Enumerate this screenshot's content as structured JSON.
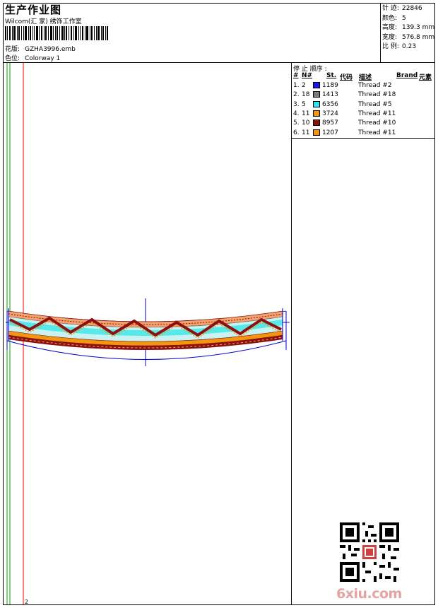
{
  "header": {
    "title": "生产作业图",
    "company": "Wilcom(汇 家) 绣饰工作室",
    "design_label": "花版:",
    "design_value": "GZHA3996.emb",
    "color_label": "色位:",
    "color_value": "Colorway 1"
  },
  "stats": [
    {
      "label": "针 迹:",
      "value": "22846"
    },
    {
      "label": "颜色:",
      "value": "5"
    },
    {
      "label": "高度:",
      "value": "139.3 mm"
    },
    {
      "label": "宽度:",
      "value": "576.8 mm"
    },
    {
      "label": "比 例:",
      "value": "0.23"
    }
  ],
  "stop_sequence": {
    "title": "停 止 顺序 :",
    "headers": {
      "num": "#",
      "n": "N#",
      "st": "St.",
      "code": "代码",
      "desc": "描述",
      "brand": "Brand",
      "element": "元素"
    },
    "rows": [
      {
        "idx": "1.",
        "n": "2",
        "color": "#1a1ae6",
        "st": "1189",
        "desc": "Thread #2"
      },
      {
        "idx": "2.",
        "n": "18",
        "color": "#7a7a7a",
        "st": "1413",
        "desc": "Thread #18"
      },
      {
        "idx": "3.",
        "n": "5",
        "color": "#2ee6e6",
        "st": "6356",
        "desc": "Thread #5"
      },
      {
        "idx": "4.",
        "n": "11",
        "color": "#f2960f",
        "st": "3724",
        "desc": "Thread #11"
      },
      {
        "idx": "5.",
        "n": "10",
        "color": "#8c1010",
        "st": "8957",
        "desc": "Thread #10"
      },
      {
        "idx": "6.",
        "n": "11",
        "color": "#f2960f",
        "st": "1207",
        "desc": "Thread #11"
      }
    ]
  },
  "footer_mark": "2",
  "watermark": "6xiu.com",
  "colors": {
    "red_guide": "#ff0000",
    "green_guide": "#00a000",
    "blue_outline": "#0000cc"
  }
}
